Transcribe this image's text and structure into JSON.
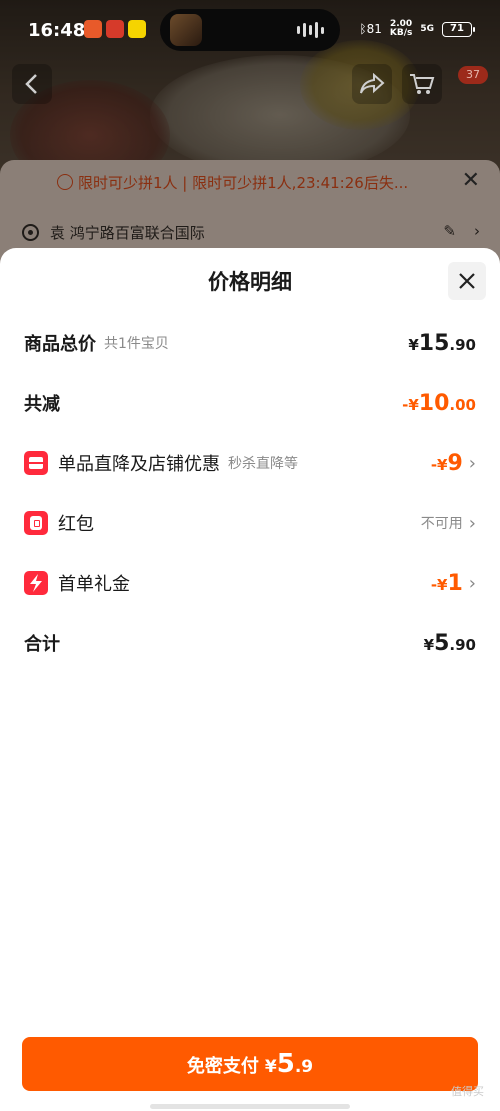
{
  "status_bar": {
    "time": "16:48",
    "signal": "ᛒ81",
    "net_speed_value": "2.00",
    "net_speed_unit": "KB/s",
    "network": "5G",
    "battery": "71"
  },
  "product_nav": {
    "badge": "37"
  },
  "notice": {
    "text": "限时可少拼1人 | 限时可少拼1人,23:41:26后失..."
  },
  "address": {
    "text": "袁 鸿宁路百富联合国际"
  },
  "sheet": {
    "title": "价格明细",
    "rows": [
      {
        "label": "商品总价",
        "sub": "共1件宝贝",
        "yen": "¥",
        "int": "15",
        "dec": ".90"
      },
      {
        "label": "共减",
        "yen": "-¥",
        "int": "10",
        "dec": ".00"
      },
      {
        "label": "单品直降及店铺优惠",
        "sub": "秒杀直降等",
        "yen": "-¥",
        "int": "9",
        "dec": ""
      },
      {
        "label": "红包",
        "value": "不可用"
      },
      {
        "label": "首单礼金",
        "yen": "-¥",
        "int": "1",
        "dec": ""
      },
      {
        "label": "合计",
        "yen": "¥",
        "int": "5",
        "dec": ".90"
      }
    ]
  },
  "pay_button": {
    "label": "免密支付",
    "yen": "¥",
    "amount": "5",
    "decimal": ".9"
  },
  "watermark": "值得买",
  "colors": {
    "accent": "#ff5a00",
    "icon_red": "#ff2a3c"
  }
}
